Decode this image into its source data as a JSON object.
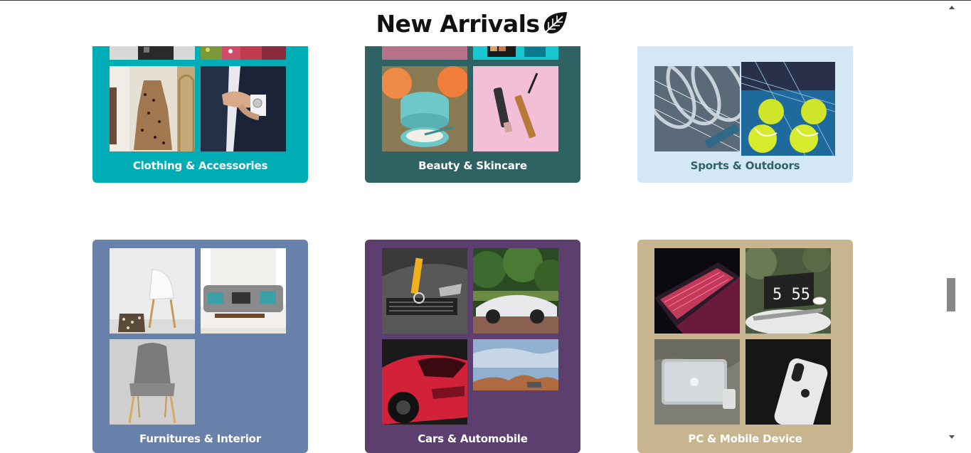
{
  "header": {
    "title": "New Arrivals",
    "icon": "leaf-icon"
  },
  "colors": {
    "clothing": "#00adb5",
    "beauty": "#2e6263",
    "sports": "#d4e7f5",
    "furniture": "#6881ab",
    "cars": "#5c3e6f",
    "pc": "#c6b58f"
  },
  "categories": [
    {
      "label": "Clothing & Accessories"
    },
    {
      "label": "Beauty & Skincare"
    },
    {
      "label": "Sports & Outdoors"
    },
    {
      "label": "Furnitures & Interior"
    },
    {
      "label": "Cars & Automobile"
    },
    {
      "label": "PC & Mobile Device"
    }
  ],
  "pc_tile": {
    "clock_text": "5 55"
  }
}
